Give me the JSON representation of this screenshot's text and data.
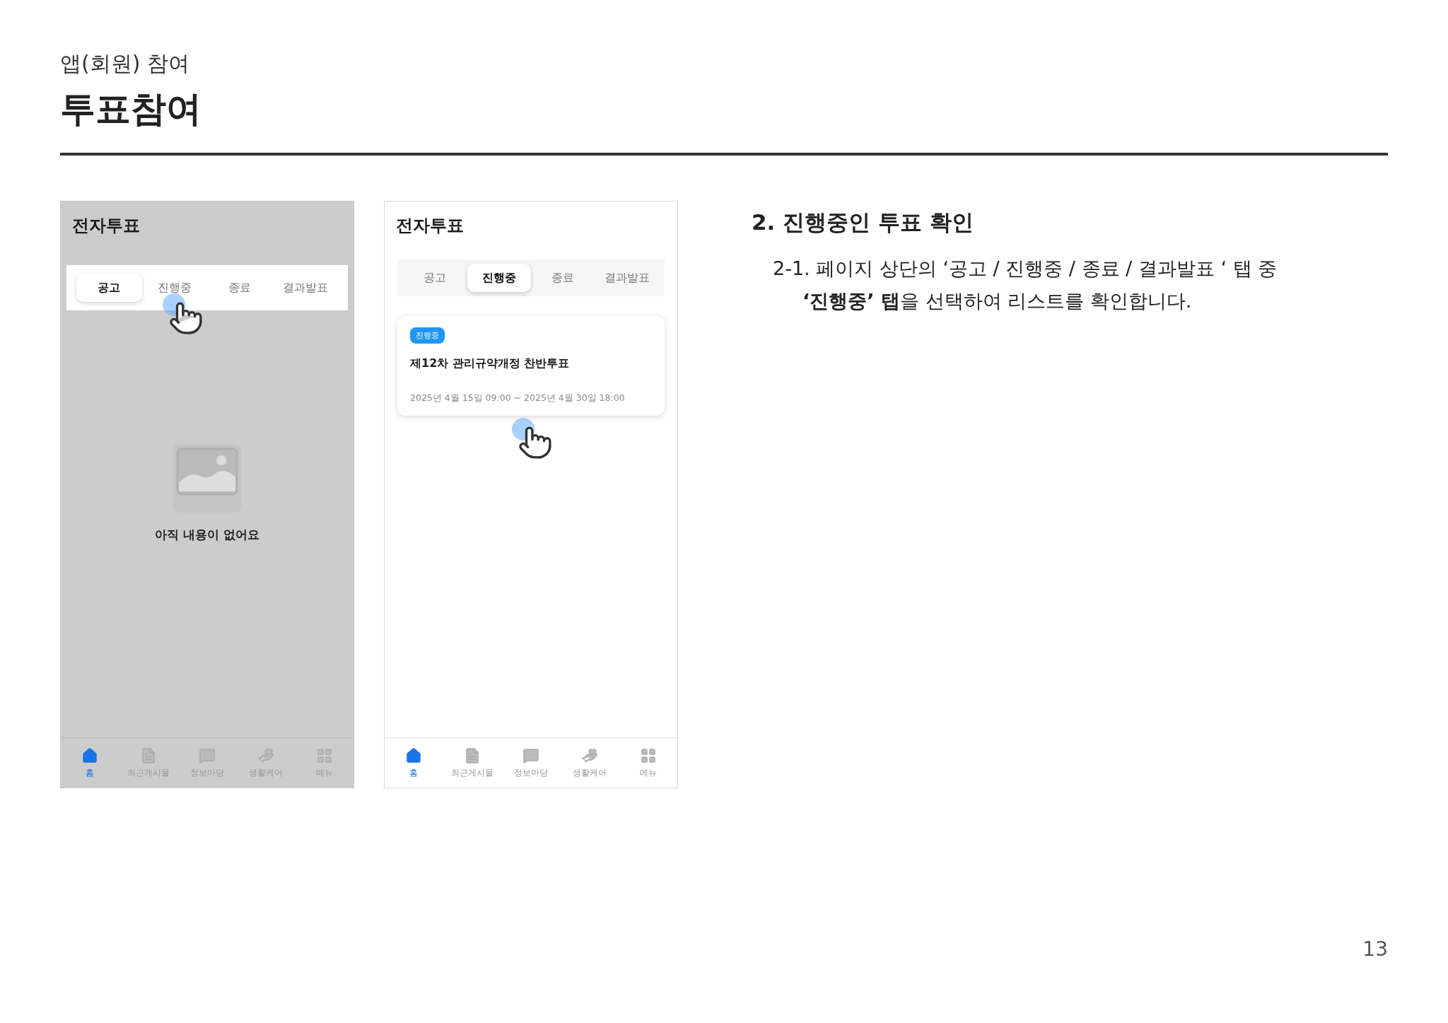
{
  "header": {
    "subtitle": "앱(회원) 참여",
    "title": "투표참여"
  },
  "screens": [
    {
      "title": "전자투표",
      "dimmed": true,
      "tabs": [
        {
          "label": "공고",
          "selected": true,
          "tapped": false
        },
        {
          "label": "진행중",
          "selected": false,
          "tapped": true
        },
        {
          "label": "종료",
          "selected": false
        },
        {
          "label": "결과발표",
          "selected": false
        }
      ],
      "content": {
        "kind": "empty",
        "message": "아직 내용이 없어요"
      },
      "nav": [
        {
          "label": "홈",
          "selected": true
        },
        {
          "label": "최근게시물",
          "selected": false
        },
        {
          "label": "정보마당",
          "selected": false
        },
        {
          "label": "생활케어",
          "selected": false
        },
        {
          "label": "메뉴",
          "selected": false
        }
      ]
    },
    {
      "title": "전자투표",
      "dimmed": false,
      "tabs": [
        {
          "label": "공고",
          "selected": false
        },
        {
          "label": "진행중",
          "selected": true
        },
        {
          "label": "종료",
          "selected": false
        },
        {
          "label": "결과발표",
          "selected": false
        }
      ],
      "content": {
        "kind": "list",
        "items": [
          {
            "tapped": true,
            "badge": "진행중",
            "title": "제12차 관리규약개정 찬반투표",
            "period": "2025년 4월 15일 09:00 ~ 2025년 4월 30일 18:00"
          }
        ]
      },
      "nav": [
        {
          "label": "홈",
          "selected": true
        },
        {
          "label": "최근게시물",
          "selected": false
        },
        {
          "label": "정보마당",
          "selected": false
        },
        {
          "label": "생활케어",
          "selected": false
        },
        {
          "label": "메뉴",
          "selected": false
        }
      ]
    }
  ],
  "description": {
    "heading": "2. 진행중인 투표 확인",
    "step": "2-1. 페이지 상단의 ‘공고 / 진행중 / 종료 / 결과발표 ‘ 탭 중",
    "step_cont": "**‘진행중’ 탭**을 선택하여 리스트를 확인합니다."
  },
  "page_number": "13"
}
